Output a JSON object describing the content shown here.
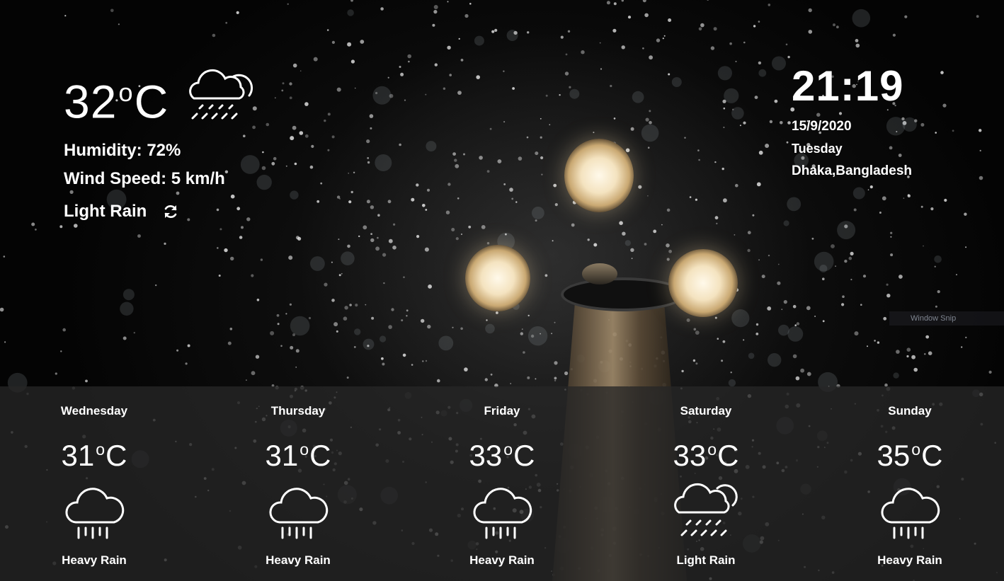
{
  "current": {
    "temperature": "32",
    "unit": "C",
    "icon": "light-rain-icon",
    "humidity": "Humidity: 72%",
    "wind_speed": "Wind Speed: 5 km/h",
    "condition": "Light Rain",
    "refresh_icon": "refresh-icon"
  },
  "clock": {
    "time": "21:19",
    "date": "15/9/2020",
    "day": "Tuesday",
    "location": "Dhaka,Bangladesh"
  },
  "overlay": {
    "snip_label": "Window Snip"
  },
  "forecast": [
    {
      "day": "Wednesday",
      "temperature": "31",
      "unit": "C",
      "icon": "heavy-rain-icon",
      "condition": "Heavy Rain"
    },
    {
      "day": "Thursday",
      "temperature": "31",
      "unit": "C",
      "icon": "heavy-rain-icon",
      "condition": "Heavy Rain"
    },
    {
      "day": "Friday",
      "temperature": "33",
      "unit": "C",
      "icon": "heavy-rain-icon",
      "condition": "Heavy Rain"
    },
    {
      "day": "Saturday",
      "temperature": "33",
      "unit": "C",
      "icon": "light-rain-icon",
      "condition": "Light Rain"
    },
    {
      "day": "Sunday",
      "temperature": "35",
      "unit": "C",
      "icon": "heavy-rain-icon",
      "condition": "Heavy Rain"
    }
  ]
}
